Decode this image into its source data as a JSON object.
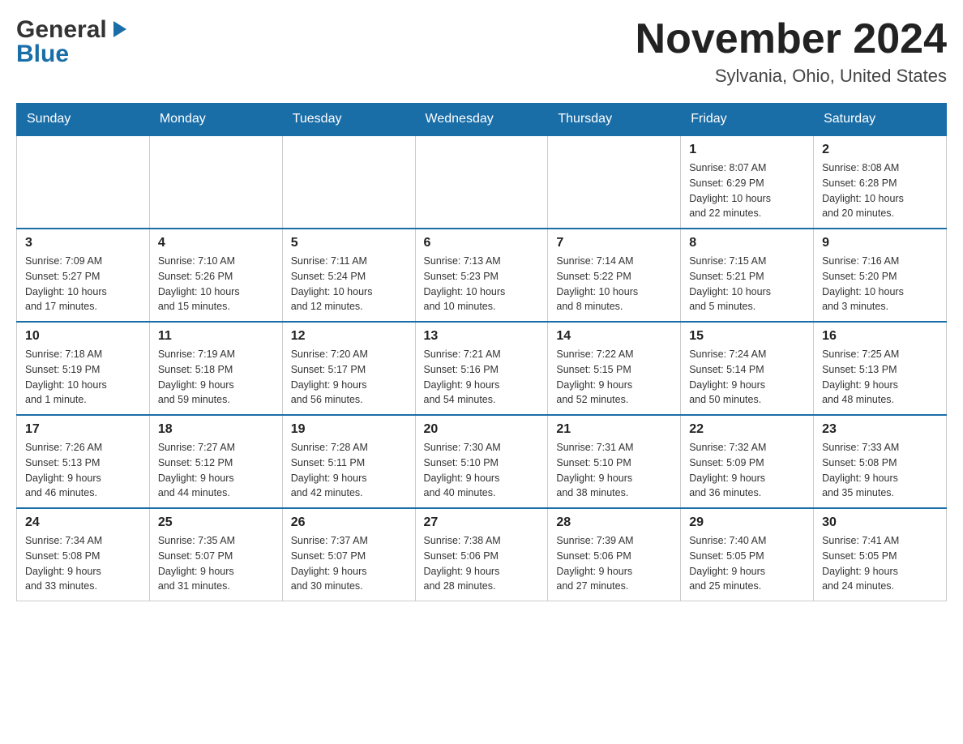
{
  "header": {
    "logo_general": "General",
    "logo_blue": "Blue",
    "month_year": "November 2024",
    "location": "Sylvania, Ohio, United States"
  },
  "weekdays": [
    "Sunday",
    "Monday",
    "Tuesday",
    "Wednesday",
    "Thursday",
    "Friday",
    "Saturday"
  ],
  "weeks": [
    {
      "days": [
        {
          "number": "",
          "info": ""
        },
        {
          "number": "",
          "info": ""
        },
        {
          "number": "",
          "info": ""
        },
        {
          "number": "",
          "info": ""
        },
        {
          "number": "",
          "info": ""
        },
        {
          "number": "1",
          "info": "Sunrise: 8:07 AM\nSunset: 6:29 PM\nDaylight: 10 hours\nand 22 minutes."
        },
        {
          "number": "2",
          "info": "Sunrise: 8:08 AM\nSunset: 6:28 PM\nDaylight: 10 hours\nand 20 minutes."
        }
      ]
    },
    {
      "days": [
        {
          "number": "3",
          "info": "Sunrise: 7:09 AM\nSunset: 5:27 PM\nDaylight: 10 hours\nand 17 minutes."
        },
        {
          "number": "4",
          "info": "Sunrise: 7:10 AM\nSunset: 5:26 PM\nDaylight: 10 hours\nand 15 minutes."
        },
        {
          "number": "5",
          "info": "Sunrise: 7:11 AM\nSunset: 5:24 PM\nDaylight: 10 hours\nand 12 minutes."
        },
        {
          "number": "6",
          "info": "Sunrise: 7:13 AM\nSunset: 5:23 PM\nDaylight: 10 hours\nand 10 minutes."
        },
        {
          "number": "7",
          "info": "Sunrise: 7:14 AM\nSunset: 5:22 PM\nDaylight: 10 hours\nand 8 minutes."
        },
        {
          "number": "8",
          "info": "Sunrise: 7:15 AM\nSunset: 5:21 PM\nDaylight: 10 hours\nand 5 minutes."
        },
        {
          "number": "9",
          "info": "Sunrise: 7:16 AM\nSunset: 5:20 PM\nDaylight: 10 hours\nand 3 minutes."
        }
      ]
    },
    {
      "days": [
        {
          "number": "10",
          "info": "Sunrise: 7:18 AM\nSunset: 5:19 PM\nDaylight: 10 hours\nand 1 minute."
        },
        {
          "number": "11",
          "info": "Sunrise: 7:19 AM\nSunset: 5:18 PM\nDaylight: 9 hours\nand 59 minutes."
        },
        {
          "number": "12",
          "info": "Sunrise: 7:20 AM\nSunset: 5:17 PM\nDaylight: 9 hours\nand 56 minutes."
        },
        {
          "number": "13",
          "info": "Sunrise: 7:21 AM\nSunset: 5:16 PM\nDaylight: 9 hours\nand 54 minutes."
        },
        {
          "number": "14",
          "info": "Sunrise: 7:22 AM\nSunset: 5:15 PM\nDaylight: 9 hours\nand 52 minutes."
        },
        {
          "number": "15",
          "info": "Sunrise: 7:24 AM\nSunset: 5:14 PM\nDaylight: 9 hours\nand 50 minutes."
        },
        {
          "number": "16",
          "info": "Sunrise: 7:25 AM\nSunset: 5:13 PM\nDaylight: 9 hours\nand 48 minutes."
        }
      ]
    },
    {
      "days": [
        {
          "number": "17",
          "info": "Sunrise: 7:26 AM\nSunset: 5:13 PM\nDaylight: 9 hours\nand 46 minutes."
        },
        {
          "number": "18",
          "info": "Sunrise: 7:27 AM\nSunset: 5:12 PM\nDaylight: 9 hours\nand 44 minutes."
        },
        {
          "number": "19",
          "info": "Sunrise: 7:28 AM\nSunset: 5:11 PM\nDaylight: 9 hours\nand 42 minutes."
        },
        {
          "number": "20",
          "info": "Sunrise: 7:30 AM\nSunset: 5:10 PM\nDaylight: 9 hours\nand 40 minutes."
        },
        {
          "number": "21",
          "info": "Sunrise: 7:31 AM\nSunset: 5:10 PM\nDaylight: 9 hours\nand 38 minutes."
        },
        {
          "number": "22",
          "info": "Sunrise: 7:32 AM\nSunset: 5:09 PM\nDaylight: 9 hours\nand 36 minutes."
        },
        {
          "number": "23",
          "info": "Sunrise: 7:33 AM\nSunset: 5:08 PM\nDaylight: 9 hours\nand 35 minutes."
        }
      ]
    },
    {
      "days": [
        {
          "number": "24",
          "info": "Sunrise: 7:34 AM\nSunset: 5:08 PM\nDaylight: 9 hours\nand 33 minutes."
        },
        {
          "number": "25",
          "info": "Sunrise: 7:35 AM\nSunset: 5:07 PM\nDaylight: 9 hours\nand 31 minutes."
        },
        {
          "number": "26",
          "info": "Sunrise: 7:37 AM\nSunset: 5:07 PM\nDaylight: 9 hours\nand 30 minutes."
        },
        {
          "number": "27",
          "info": "Sunrise: 7:38 AM\nSunset: 5:06 PM\nDaylight: 9 hours\nand 28 minutes."
        },
        {
          "number": "28",
          "info": "Sunrise: 7:39 AM\nSunset: 5:06 PM\nDaylight: 9 hours\nand 27 minutes."
        },
        {
          "number": "29",
          "info": "Sunrise: 7:40 AM\nSunset: 5:05 PM\nDaylight: 9 hours\nand 25 minutes."
        },
        {
          "number": "30",
          "info": "Sunrise: 7:41 AM\nSunset: 5:05 PM\nDaylight: 9 hours\nand 24 minutes."
        }
      ]
    }
  ]
}
